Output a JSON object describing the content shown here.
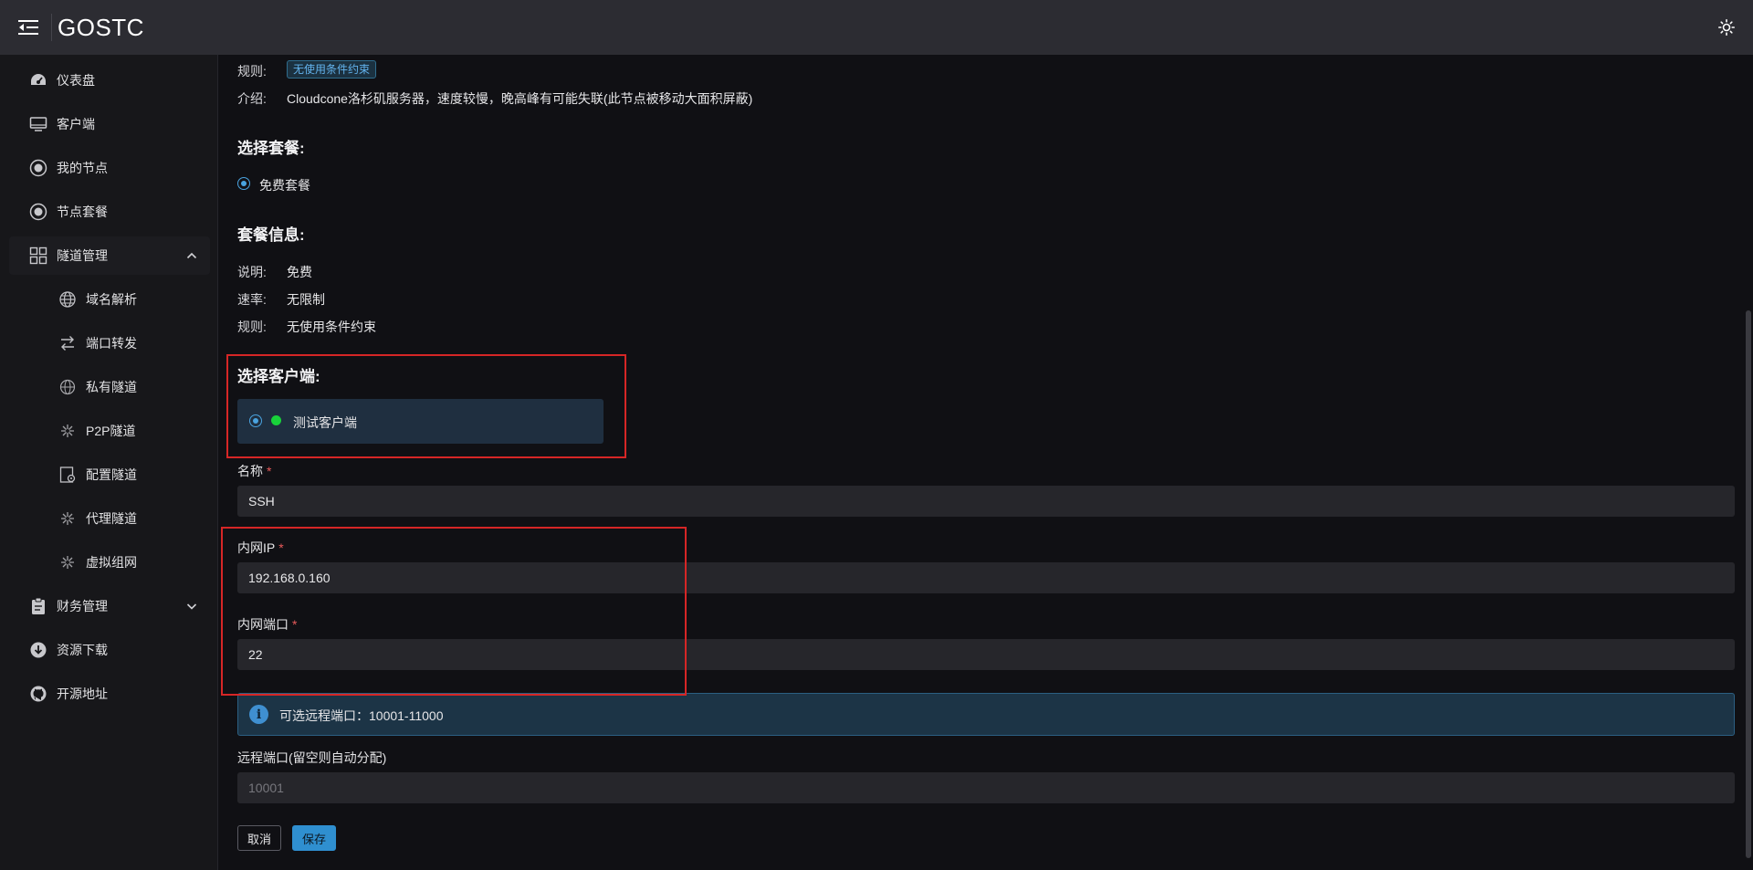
{
  "app": {
    "title": "GOSTC"
  },
  "sidebar": {
    "items": [
      {
        "label": "仪表盘",
        "icon": "dashboard-icon"
      },
      {
        "label": "客户端",
        "icon": "monitor-icon"
      },
      {
        "label": "我的节点",
        "icon": "node-icon"
      },
      {
        "label": "节点套餐",
        "icon": "node-plan-icon"
      },
      {
        "label": "隧道管理",
        "icon": "grid-icon",
        "expanded": true
      },
      {
        "label": "域名解析",
        "icon": "globe-icon"
      },
      {
        "label": "端口转发",
        "icon": "transfer-icon"
      },
      {
        "label": "私有隧道",
        "icon": "network-globe-icon"
      },
      {
        "label": "P2P隧道",
        "icon": "p2p-icon"
      },
      {
        "label": "配置隧道",
        "icon": "config-icon"
      },
      {
        "label": "代理隧道",
        "icon": "proxy-icon"
      },
      {
        "label": "虚拟组网",
        "icon": "vnet-icon"
      },
      {
        "label": "财务管理",
        "icon": "clipboard-icon",
        "expanded": false
      },
      {
        "label": "资源下载",
        "icon": "download-icon"
      },
      {
        "label": "开源地址",
        "icon": "github-icon"
      }
    ]
  },
  "node_info": {
    "rule_label": "规则:",
    "rule_tag": "无使用条件约束",
    "intro_label": "介绍:",
    "intro_value": "Cloudcone洛杉矶服务器，速度较慢，晚高峰有可能失联(此节点被移动大面积屏蔽)"
  },
  "plan_select": {
    "title": "选择套餐:",
    "option": "免费套餐",
    "selected": true
  },
  "plan_info": {
    "title": "套餐信息:",
    "rows": [
      {
        "label": "说明:",
        "value": "免费"
      },
      {
        "label": "速率:",
        "value": "无限制"
      },
      {
        "label": "规则:",
        "value": "无使用条件约束"
      }
    ]
  },
  "client_select": {
    "title": "选择客户端:",
    "client_name": "测试客户端",
    "status_color": "#18d23a",
    "selected": true
  },
  "form": {
    "name_label": "名称",
    "name_value": "SSH",
    "ip_label": "内网IP",
    "ip_value": "192.168.0.160",
    "port_label": "内网端口",
    "port_value": "22",
    "required_mark": "*",
    "info_text": "可选远程端口：10001-11000",
    "remote_label": "远程端口(留空则自动分配)",
    "remote_placeholder": "10001",
    "cancel": "取消",
    "save": "保存"
  },
  "colors": {
    "accent": "#2f8fd0",
    "highlight": "#d62626"
  }
}
